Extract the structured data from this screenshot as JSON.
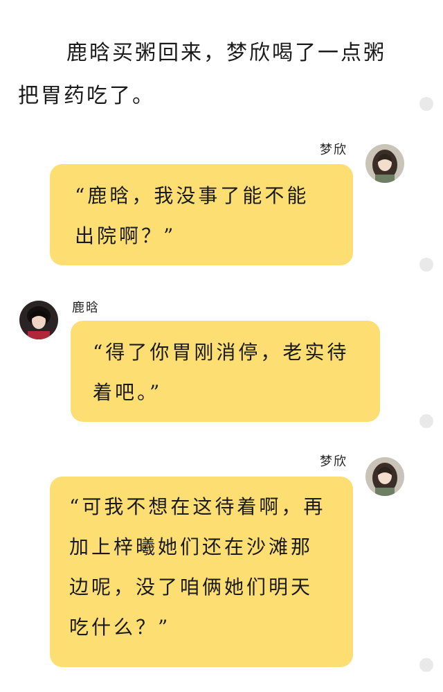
{
  "narration": "鹿晗买粥回来，梦欣喝了一点粥把胃药吃了。",
  "messages": [
    {
      "speaker": "梦欣",
      "side": "right",
      "avatar_icon": "girl-portrait-avatar",
      "text": "“鹿晗，我没事了能不能出院啊？”"
    },
    {
      "speaker": "鹿晗",
      "side": "left",
      "avatar_icon": "boy-portrait-avatar",
      "text": "“得了你胃刚消停，老实待着吧。”"
    },
    {
      "speaker": "梦欣",
      "side": "right",
      "avatar_icon": "girl-portrait-avatar",
      "text": "“可我不想在这待着啊，再加上梓曦她们还在沙滩那边呢，没了咱俩她们明天吃什么？”"
    }
  ],
  "colors": {
    "bubble": "#fcde72",
    "background": "#ffffff",
    "rail_dot": "#e9e9e9"
  }
}
